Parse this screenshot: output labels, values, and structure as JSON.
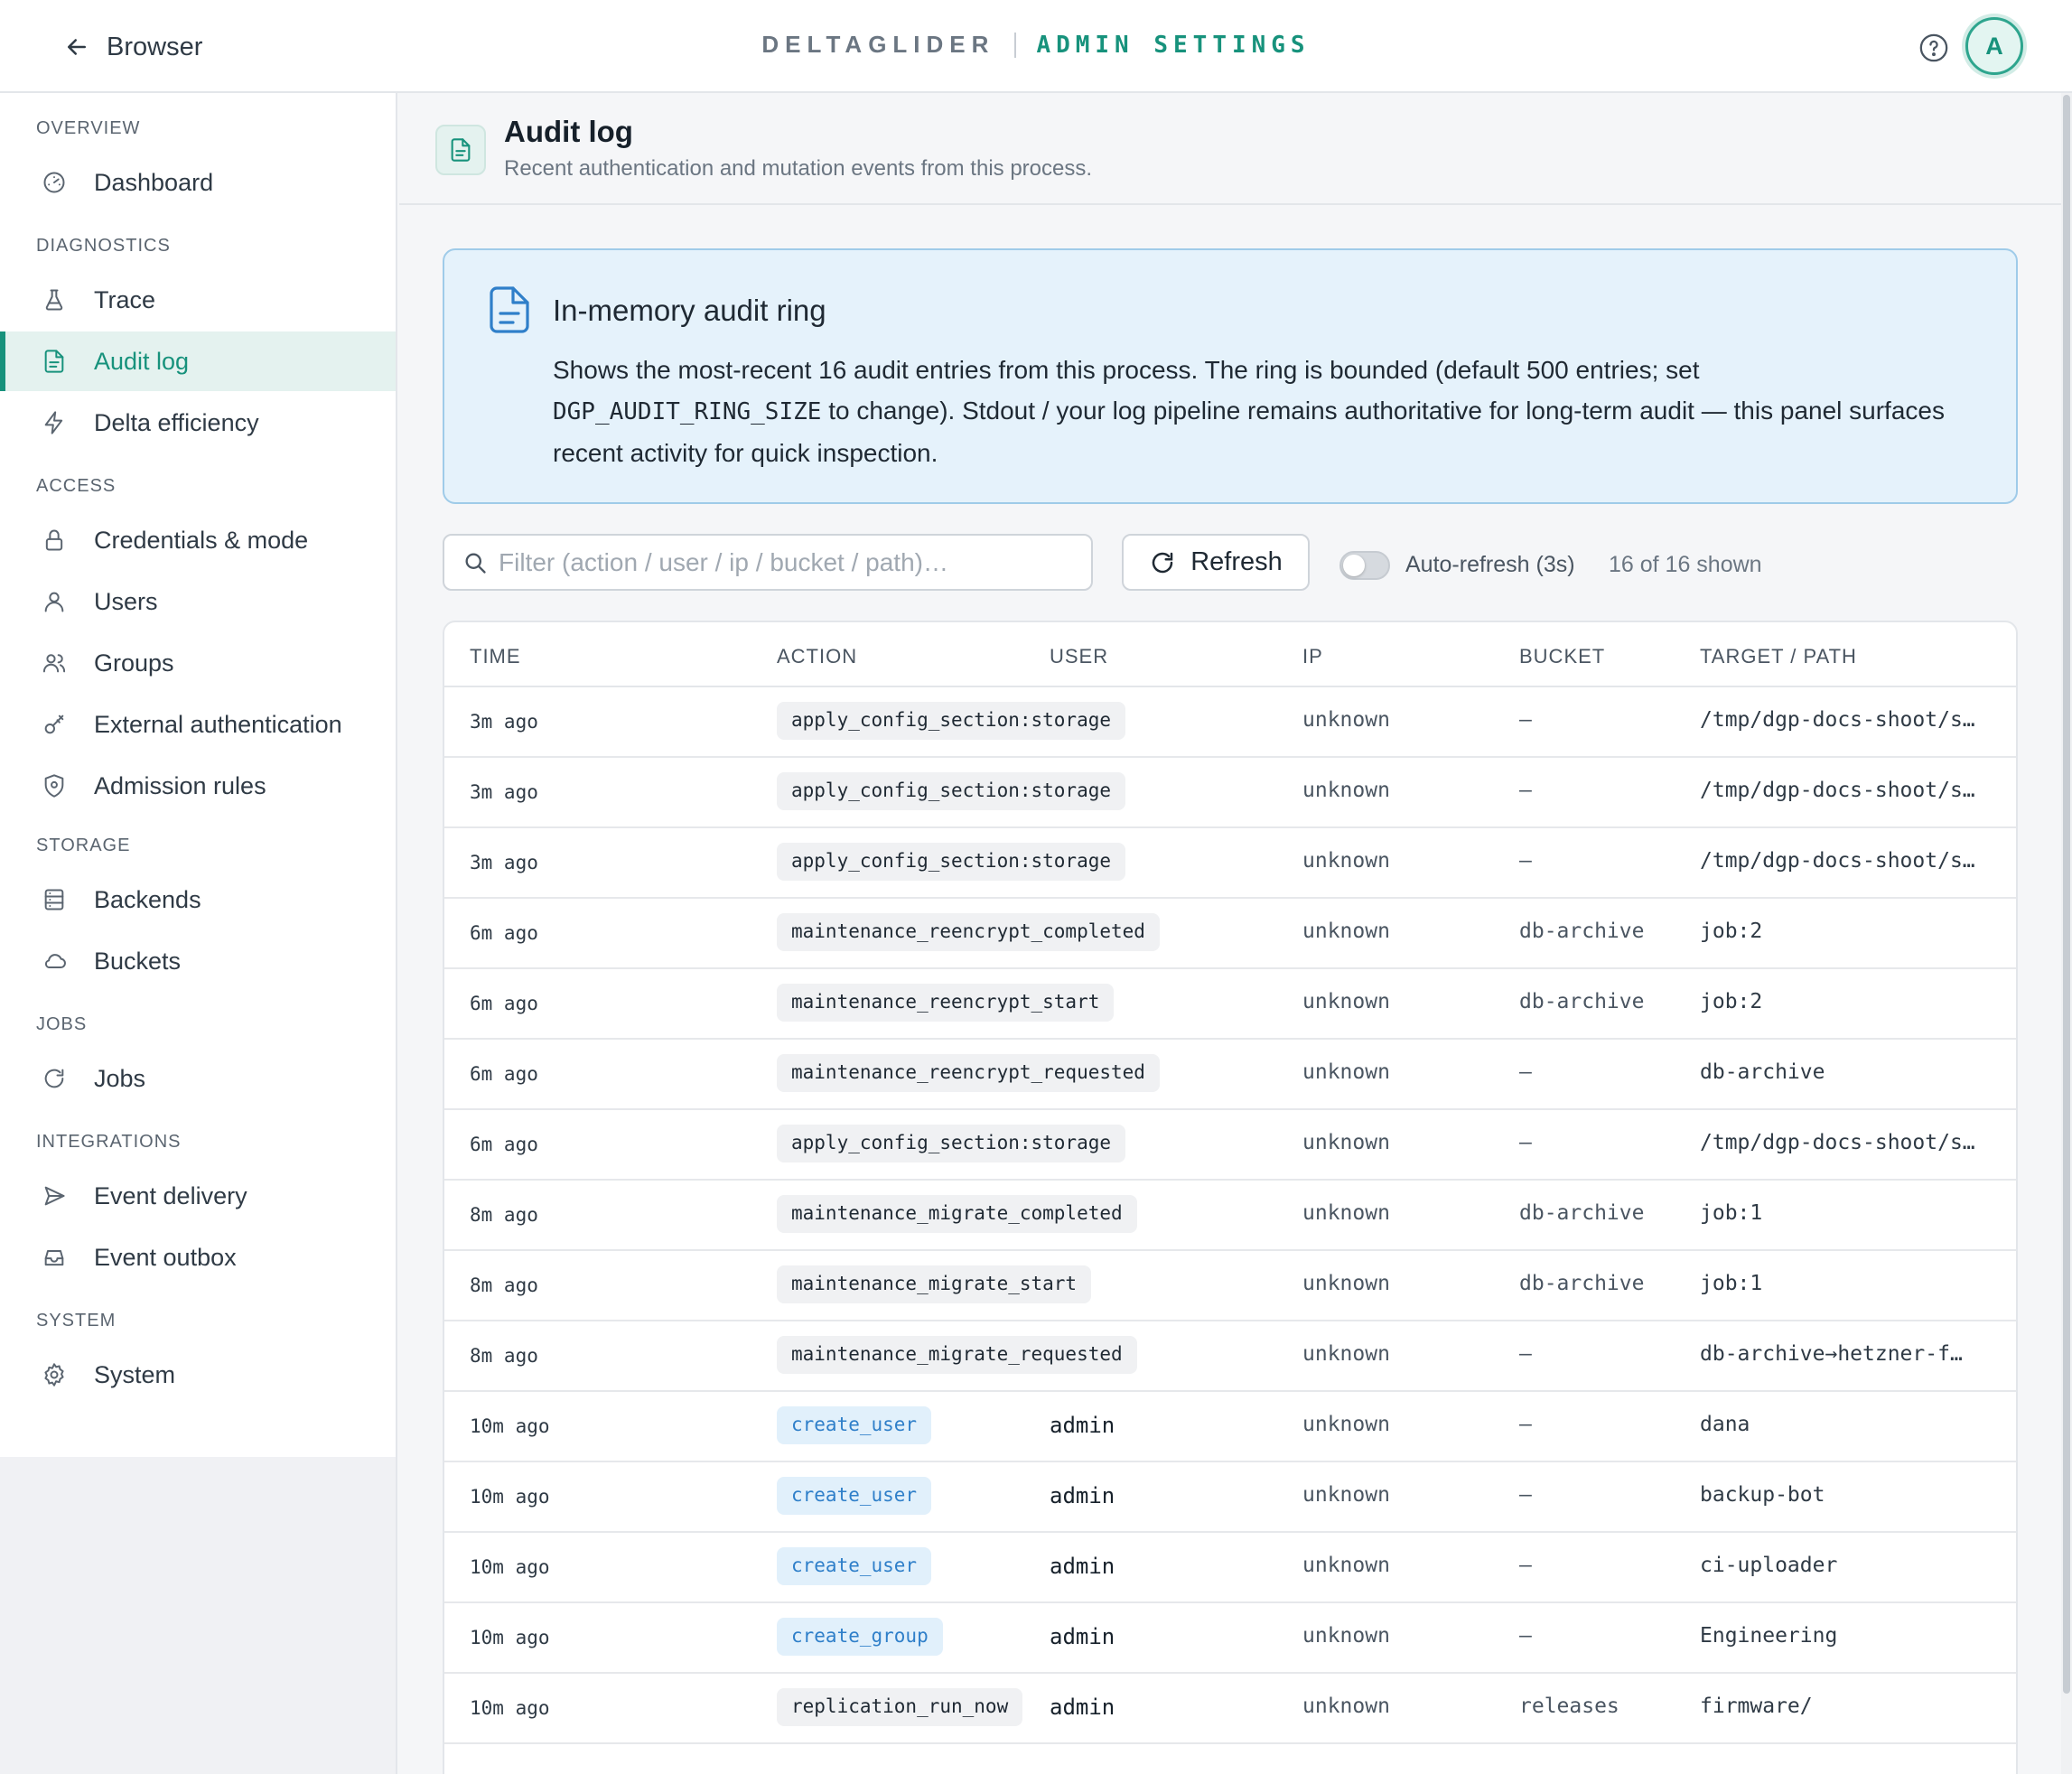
{
  "header": {
    "back_label": "Browser",
    "brand": "DELTAGLIDER",
    "section": "ADMIN SETTINGS",
    "avatar_initial": "A",
    "help_icon": "help-circle-icon"
  },
  "sidebar": {
    "groups": [
      {
        "heading": "OVERVIEW",
        "items": [
          {
            "label": "Dashboard",
            "icon": "gauge-icon"
          }
        ]
      },
      {
        "heading": "DIAGNOSTICS",
        "items": [
          {
            "label": "Trace",
            "icon": "flask-icon"
          },
          {
            "label": "Audit log",
            "icon": "document-icon",
            "active": true
          },
          {
            "label": "Delta efficiency",
            "icon": "lightning-icon"
          }
        ]
      },
      {
        "heading": "ACCESS",
        "items": [
          {
            "label": "Credentials & mode",
            "icon": "lock-icon"
          },
          {
            "label": "Users",
            "icon": "user-icon"
          },
          {
            "label": "Groups",
            "icon": "group-icon"
          },
          {
            "label": "External authentication",
            "icon": "key-icon"
          },
          {
            "label": "Admission rules",
            "icon": "shield-icon"
          }
        ]
      },
      {
        "heading": "STORAGE",
        "items": [
          {
            "label": "Backends",
            "icon": "server-icon"
          },
          {
            "label": "Buckets",
            "icon": "cloud-icon"
          }
        ]
      },
      {
        "heading": "JOBS",
        "items": [
          {
            "label": "Jobs",
            "icon": "refresh-icon"
          }
        ]
      },
      {
        "heading": "INTEGRATIONS",
        "items": [
          {
            "label": "Event delivery",
            "icon": "send-icon"
          },
          {
            "label": "Event outbox",
            "icon": "outbox-icon"
          }
        ]
      },
      {
        "heading": "SYSTEM",
        "items": [
          {
            "label": "System",
            "icon": "gear-icon"
          }
        ]
      }
    ]
  },
  "page": {
    "title": "Audit log",
    "subtitle": "Recent authentication and mutation events from this process."
  },
  "info": {
    "title": "In-memory audit ring",
    "body_1": "Shows the most-recent 16 audit entries from this process. The ring is bounded (default 500 entries; set",
    "code": "DGP_AUDIT_RING_SIZE",
    "body_2": " to change). Stdout / your log pipeline remains authoritative for long-term audit — this panel surfaces recent activity for quick inspection."
  },
  "toolbar": {
    "filter_placeholder": "Filter (action / user / ip / bucket / path)…",
    "filter_value": "",
    "refresh_label": "Refresh",
    "auto_refresh_label": "Auto-refresh (3s)",
    "auto_refresh_on": false,
    "shown_count": "16 of 16 shown"
  },
  "table": {
    "columns": [
      "TIME",
      "ACTION",
      "USER",
      "IP",
      "BUCKET",
      "TARGET / PATH"
    ],
    "rows": [
      {
        "time": "3m ago",
        "action": "apply_config_section:storage",
        "user": "",
        "ip": "unknown",
        "bucket": "—",
        "target": "/tmp/dgp-docs-shoot/s…",
        "style": "grey"
      },
      {
        "time": "3m ago",
        "action": "apply_config_section:storage",
        "user": "",
        "ip": "unknown",
        "bucket": "—",
        "target": "/tmp/dgp-docs-shoot/s…",
        "style": "grey"
      },
      {
        "time": "3m ago",
        "action": "apply_config_section:storage",
        "user": "",
        "ip": "unknown",
        "bucket": "—",
        "target": "/tmp/dgp-docs-shoot/s…",
        "style": "grey"
      },
      {
        "time": "6m ago",
        "action": "maintenance_reencrypt_completed",
        "user": "",
        "ip": "unknown",
        "bucket": "db-archive",
        "target": "job:2",
        "style": "grey"
      },
      {
        "time": "6m ago",
        "action": "maintenance_reencrypt_start",
        "user": "",
        "ip": "unknown",
        "bucket": "db-archive",
        "target": "job:2",
        "style": "grey"
      },
      {
        "time": "6m ago",
        "action": "maintenance_reencrypt_requested",
        "user": "",
        "ip": "unknown",
        "bucket": "—",
        "target": "db-archive",
        "style": "grey"
      },
      {
        "time": "6m ago",
        "action": "apply_config_section:storage",
        "user": "",
        "ip": "unknown",
        "bucket": "—",
        "target": "/tmp/dgp-docs-shoot/s…",
        "style": "grey"
      },
      {
        "time": "8m ago",
        "action": "maintenance_migrate_completed",
        "user": "",
        "ip": "unknown",
        "bucket": "db-archive",
        "target": "job:1",
        "style": "grey"
      },
      {
        "time": "8m ago",
        "action": "maintenance_migrate_start",
        "user": "",
        "ip": "unknown",
        "bucket": "db-archive",
        "target": "job:1",
        "style": "grey"
      },
      {
        "time": "8m ago",
        "action": "maintenance_migrate_requested",
        "user": "",
        "ip": "unknown",
        "bucket": "—",
        "target": "db-archive→hetzner-f…",
        "style": "grey"
      },
      {
        "time": "10m ago",
        "action": "create_user",
        "user": "admin",
        "ip": "unknown",
        "bucket": "—",
        "target": "dana",
        "style": "blue"
      },
      {
        "time": "10m ago",
        "action": "create_user",
        "user": "admin",
        "ip": "unknown",
        "bucket": "—",
        "target": "backup-bot",
        "style": "blue"
      },
      {
        "time": "10m ago",
        "action": "create_user",
        "user": "admin",
        "ip": "unknown",
        "bucket": "—",
        "target": "ci-uploader",
        "style": "blue"
      },
      {
        "time": "10m ago",
        "action": "create_group",
        "user": "admin",
        "ip": "unknown",
        "bucket": "—",
        "target": "Engineering",
        "style": "blue"
      },
      {
        "time": "10m ago",
        "action": "replication_run_now",
        "user": "admin",
        "ip": "unknown",
        "bucket": "releases",
        "target": "firmware/",
        "style": "grey"
      }
    ]
  },
  "colors": {
    "accent": "#17927c",
    "info_bg": "#e5f2fb",
    "info_border": "#9fcbe9",
    "tag_blue": "#2f7fc9"
  }
}
